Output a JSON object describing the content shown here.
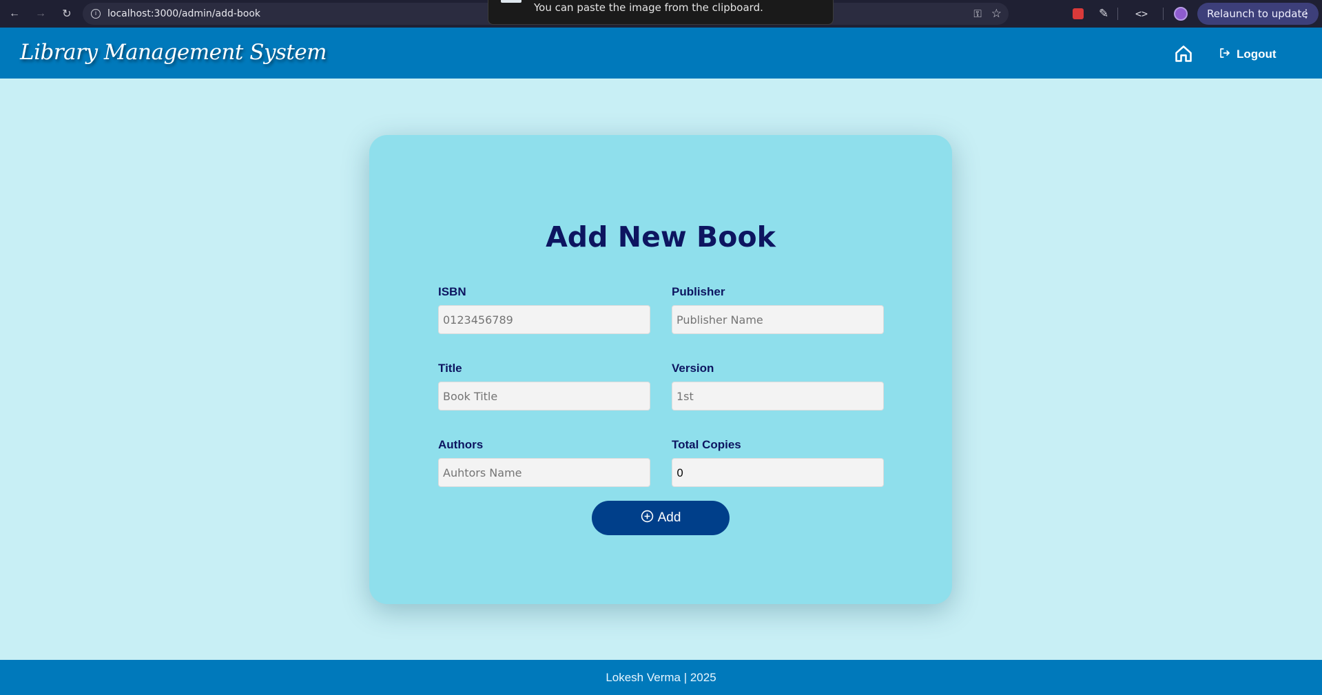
{
  "browser": {
    "url": "localhost:3000/admin/add-book",
    "toast_text": "You can paste the image from the clipboard.",
    "relaunch_label": "Relaunch to update"
  },
  "header": {
    "brand": "Library Management System",
    "logout_label": "Logout"
  },
  "form": {
    "title": "Add New Book",
    "fields": [
      {
        "label": "ISBN",
        "placeholder": "0123456789",
        "value": ""
      },
      {
        "label": "Publisher",
        "placeholder": "Publisher Name",
        "value": ""
      },
      {
        "label": "Title",
        "placeholder": "Book Title",
        "value": ""
      },
      {
        "label": "Version",
        "placeholder": "1st",
        "value": ""
      },
      {
        "label": "Authors",
        "placeholder": "Auhtors Name",
        "value": ""
      },
      {
        "label": "Total Copies",
        "placeholder": "",
        "value": "0"
      }
    ],
    "submit_label": "Add"
  },
  "footer": {
    "text": "Lokesh Verma | 2025"
  },
  "colors": {
    "header_bg": "#0079bb",
    "page_bg": "#c8eff5",
    "card_bg": "#8fdfec",
    "title_color": "#0d1560",
    "button_bg": "#003f8a"
  }
}
